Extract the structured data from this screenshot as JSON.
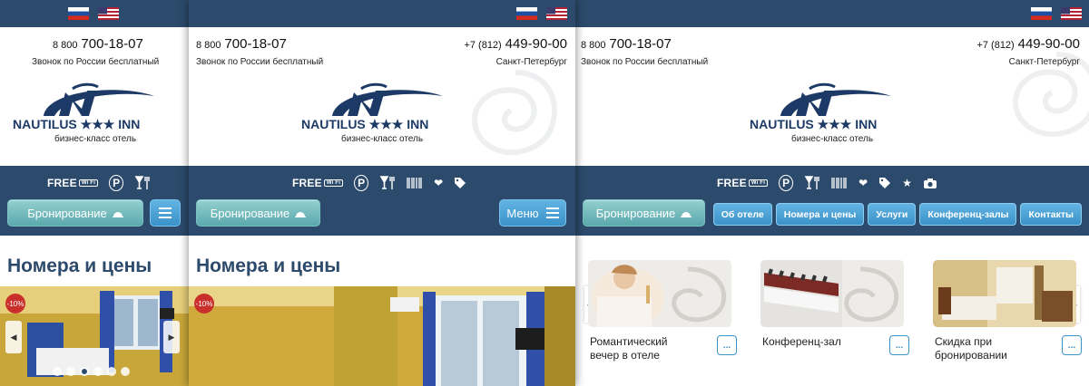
{
  "contacts": {
    "toll_prefix": "8 800",
    "toll_number": "700-18-07",
    "toll_note": "Звонок по России бесплатный",
    "spb_prefix": "+7 (812)",
    "spb_number": "449-90-00",
    "spb_note": "Санкт-Петербург"
  },
  "brand": {
    "logo_text": "NAUTILUS ★★★ INN",
    "tagline": "бизнес-класс отель",
    "colors": {
      "navy": "#2c4a6b",
      "teal": "#5aa9ac",
      "blue": "#3b93c8",
      "discount": "#c9302c"
    }
  },
  "languages": [
    {
      "icon": "russian-flag-icon",
      "selected": true
    },
    {
      "icon": "us-flag-icon",
      "selected": false
    }
  ],
  "amenities": [
    "wifi-icon",
    "parking-icon",
    "restaurant-bar-icon",
    "barcode-icon",
    "heart-icon",
    "tag-icon",
    "star-icon",
    "camera-icon"
  ],
  "amenity_free_label": "FREE",
  "amenity_wifi_label": "Wi Fi",
  "amenity_parking_label": "P",
  "booking_label": "Бронирование",
  "menu_label": "Меню",
  "nav_tabs": [
    "Об отеле",
    "Номера и цены",
    "Услуги",
    "Конференц-залы",
    "Контакты"
  ],
  "section_title": "Номера и цены",
  "discount_badge": "-10%",
  "carousel": {
    "dot_count": 6,
    "active_index": 2
  },
  "promo_cards": [
    {
      "title": "Романтический вечер в отеле",
      "more": "..."
    },
    {
      "title": "Конференц-зал",
      "more": "..."
    },
    {
      "title": "Скидка при бронировании",
      "more": "..."
    }
  ],
  "arrows": {
    "left": "◀",
    "right": "▶"
  }
}
